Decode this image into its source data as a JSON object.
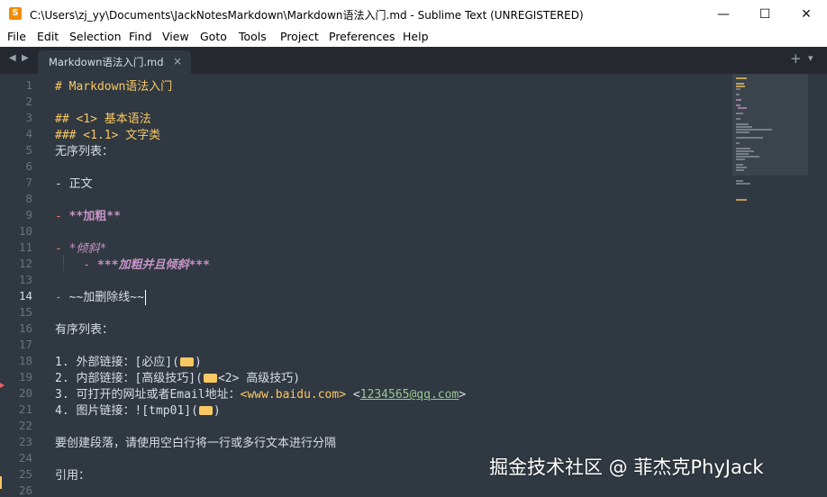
{
  "window": {
    "title": "C:\\Users\\zj_yy\\Documents\\JackNotesMarkdown\\Markdown语法入门.md - Sublime Text (UNREGISTERED)",
    "controls": {
      "minimize": "—",
      "maximize": "☐",
      "close": "✕"
    }
  },
  "menu": [
    "File",
    "Edit",
    "Selection",
    "Find",
    "View",
    "Goto",
    "Tools",
    "Project",
    "Preferences",
    "Help"
  ],
  "tabs": [
    {
      "label": "Markdown语法入门.md",
      "close": "×",
      "active": true
    }
  ],
  "tabbar": {
    "prev": "◀",
    "next": "▶",
    "add": "+",
    "overflow": "▾"
  },
  "editor": {
    "current_line": 14,
    "line_numbers": [
      "1",
      "2",
      "3",
      "4",
      "5",
      "6",
      "7",
      "8",
      "9",
      "10",
      "11",
      "12",
      "13",
      "14",
      "15",
      "16",
      "17",
      "18",
      "19",
      "20",
      "21",
      "22",
      "23",
      "24",
      "25",
      "26"
    ],
    "lines": {
      "l1": "# Markdown语法入门",
      "l3": "## <1> 基本语法",
      "l4": "### <1.1> 文字类",
      "l5": "无序列表：",
      "l7": "- 正文",
      "l9_dash": "- ",
      "l9_bold": "**加粗**",
      "l11_dash": "- ",
      "l11_italic": "*倾斜*",
      "l12_dash": "    - ",
      "l12_bi": "***加粗并且倾斜***",
      "l14_dash": "- ",
      "l14_text": "~~加删除线~~",
      "l16": "有序列表：",
      "l18_a": "1. 外部链接：[必应](",
      "l18_b": ")",
      "l19_a": "2. 内部链接：[高级技巧](",
      "l19_b": "<2> 高级技巧)",
      "l20_a": "3. 可打开的网址或者Email地址：",
      "l20_url": "<www.baidu.com>",
      "l20_sp": " <",
      "l20_mail": "1234565@qq.com",
      "l20_end": ">",
      "l21_a": "4. 图片链接：![tmp01](",
      "l21_b": ")",
      "l23": "要创建段落，请使用空白行将一行或多行文本进行分隔",
      "l25": "引用："
    }
  },
  "watermark": "掘金技术社区 @ 菲杰克PhyJack",
  "colors": {
    "background": "#303841",
    "heading": "#fac863",
    "emphasis": "#c594c5",
    "link": "#99c794",
    "marker": "#ec5f67"
  }
}
